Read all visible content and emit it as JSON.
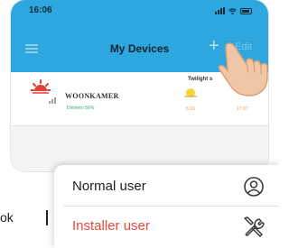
{
  "status_bar": {
    "time": "16:06"
  },
  "nav": {
    "title": "My Devices",
    "add_label": "+",
    "edit_label": "Edit"
  },
  "device": {
    "name": "WOONKAMER",
    "sub": "Dimmen 56%",
    "twilight_label": "Twilight s",
    "time_on": "6:16",
    "time_off": "17:07"
  },
  "role_menu": {
    "options": [
      {
        "label": "Normal user",
        "icon": "user-circle-icon"
      },
      {
        "label": "Installer user",
        "icon": "tools-icon"
      }
    ]
  },
  "fragment": {
    "text": "ok"
  },
  "colors": {
    "header": "#2ea7df",
    "installer": "#e8473a",
    "sun": "#e53d2f",
    "accent_time": "#e7a23a",
    "dim_text": "#2eaa63"
  }
}
